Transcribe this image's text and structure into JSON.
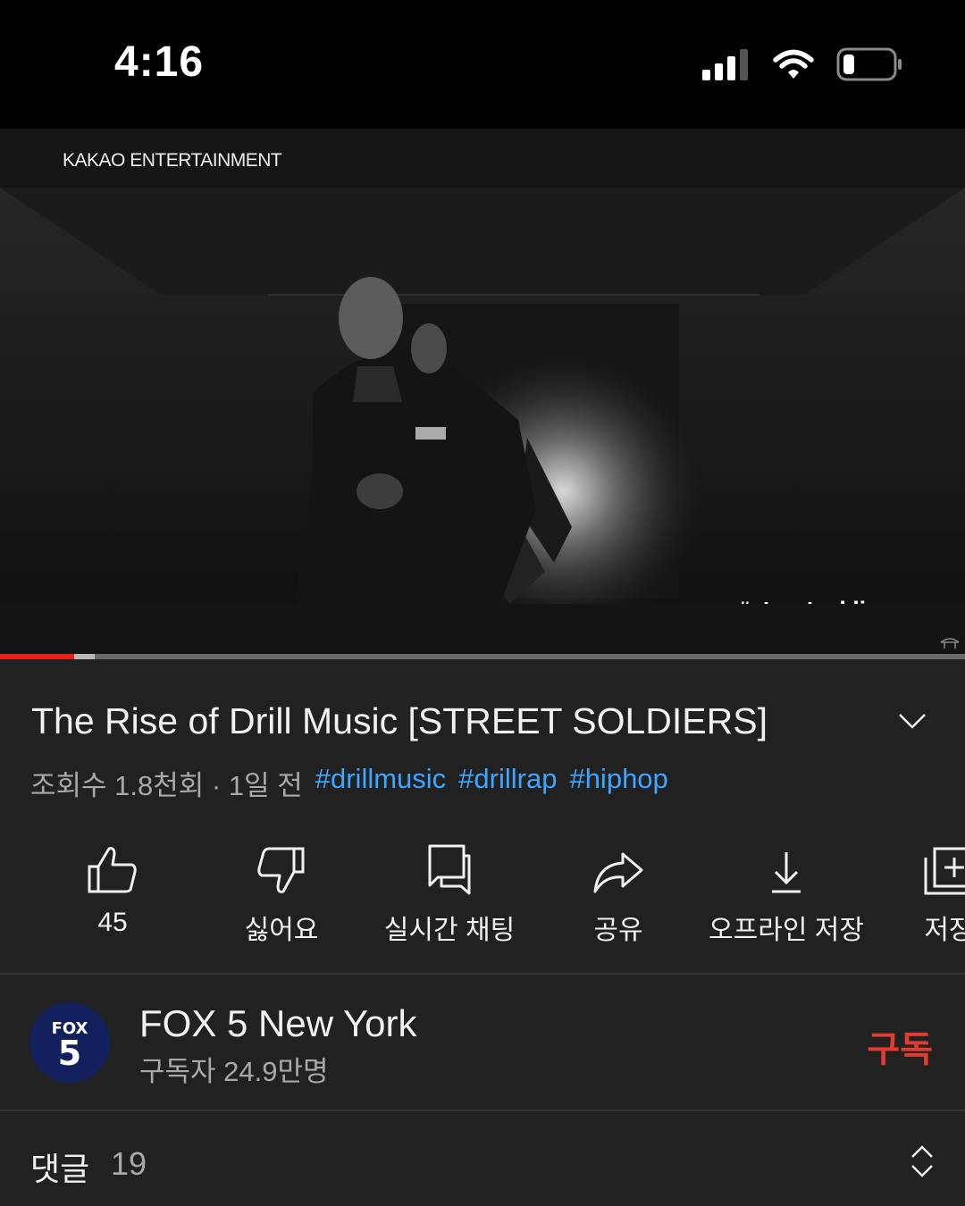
{
  "status_bar": {
    "time": "4:16",
    "icons": [
      "cellular-signal-icon",
      "wifi-icon",
      "battery-icon"
    ]
  },
  "video": {
    "watermark": "KAKAO ENTERTAINMENT",
    "overlay_tag": "#streetsoldiers",
    "progress_played": 0.077,
    "progress_buffered": 0.098
  },
  "info": {
    "title": "The Rise of Drill Music [STREET SOLDIERS]",
    "meta": "조회수 1.8천회 · 1일 전",
    "hashtags": [
      "#drillmusic",
      "#drillrap",
      "#hiphop"
    ]
  },
  "actions": [
    {
      "icon": "thumbs-up-icon",
      "label": "45"
    },
    {
      "icon": "thumbs-down-icon",
      "label": "싫어요"
    },
    {
      "icon": "live-chat-icon",
      "label": "실시간 채팅"
    },
    {
      "icon": "share-icon",
      "label": "공유"
    },
    {
      "icon": "download-icon",
      "label": "오프라인 저장"
    },
    {
      "icon": "save-playlist-icon",
      "label": "저장"
    }
  ],
  "channel": {
    "name": "FOX 5 New York",
    "subscribers": "구독자 24.9만명",
    "subscribe_label": "구독",
    "avatar_line1": "FOX",
    "avatar_line2": "5"
  },
  "comments": {
    "label": "댓글",
    "count": "19"
  },
  "colors": {
    "background": "#212121",
    "accent_red": "#e62117",
    "subscribe_red": "#e23c31",
    "hashtag_blue": "#3ea6ff",
    "secondary_text": "#a9a9a9"
  }
}
